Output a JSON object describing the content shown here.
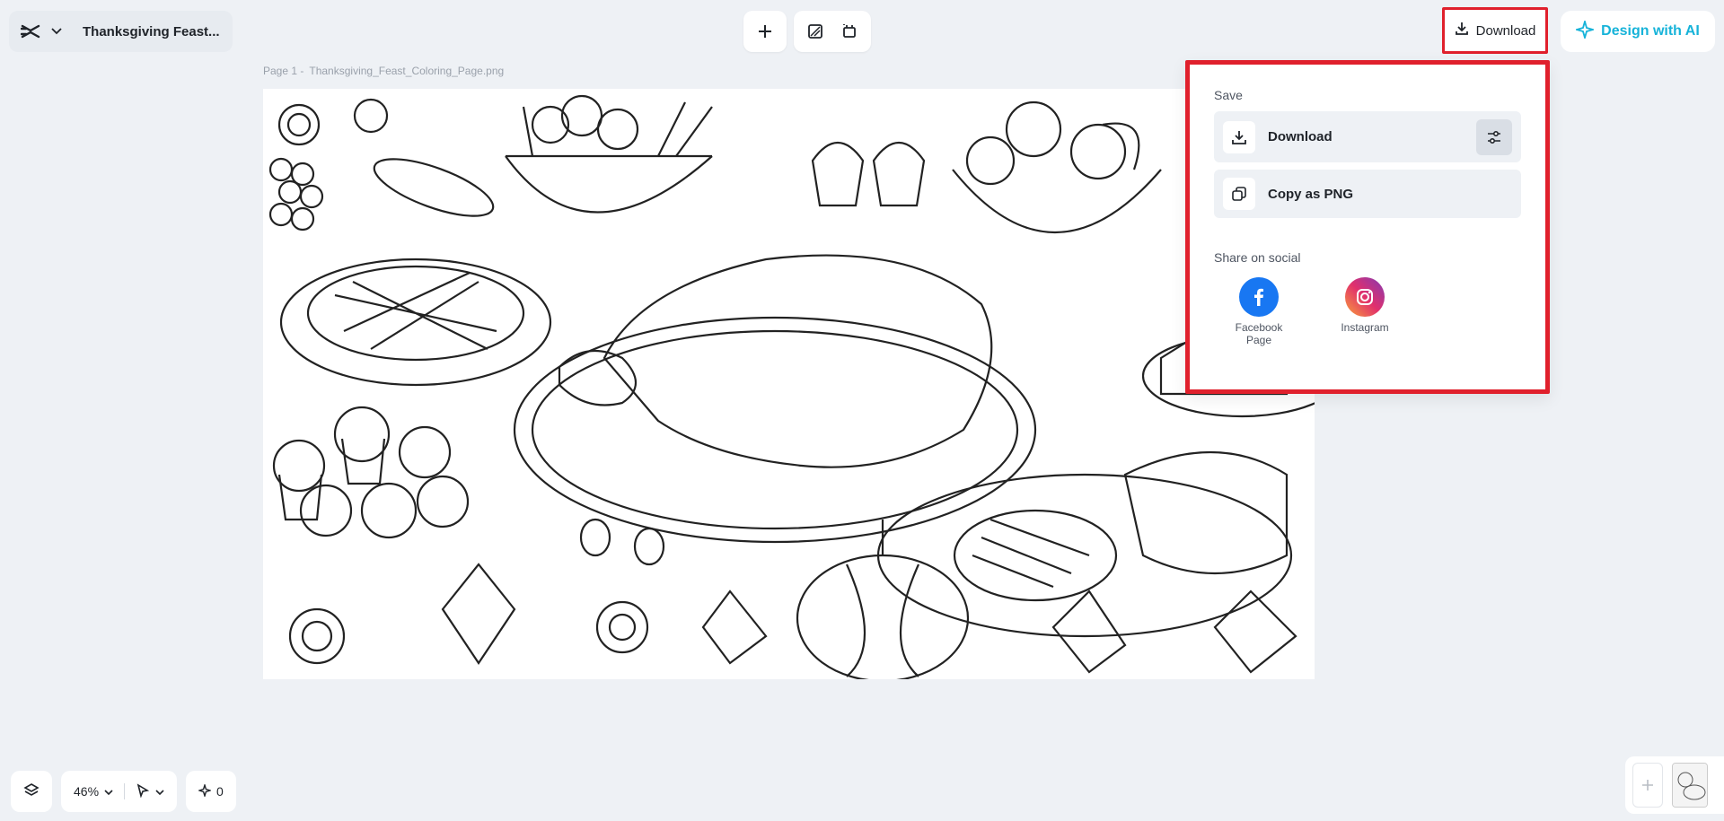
{
  "header": {
    "doc_title": "Thanksgiving Feast...",
    "download_label": "Download",
    "design_ai_label": "Design with AI"
  },
  "canvas": {
    "page_label": "Page 1 -",
    "file_name": "Thanksgiving_Feast_Coloring_Page.png"
  },
  "download_panel": {
    "save_title": "Save",
    "options": [
      {
        "label": "Download",
        "icon": "download-icon"
      },
      {
        "label": "Copy as PNG",
        "icon": "copy-icon"
      }
    ],
    "share_title": "Share on social",
    "social": [
      {
        "label": "Facebook Page",
        "color": "#1877f2"
      },
      {
        "label": "Instagram",
        "color": "#e1306c"
      }
    ]
  },
  "footer": {
    "zoom": "46%",
    "ai_count": "0"
  },
  "colors": {
    "accent": "#16b3d9",
    "highlight": "#e0202c",
    "background": "#eef1f5"
  }
}
